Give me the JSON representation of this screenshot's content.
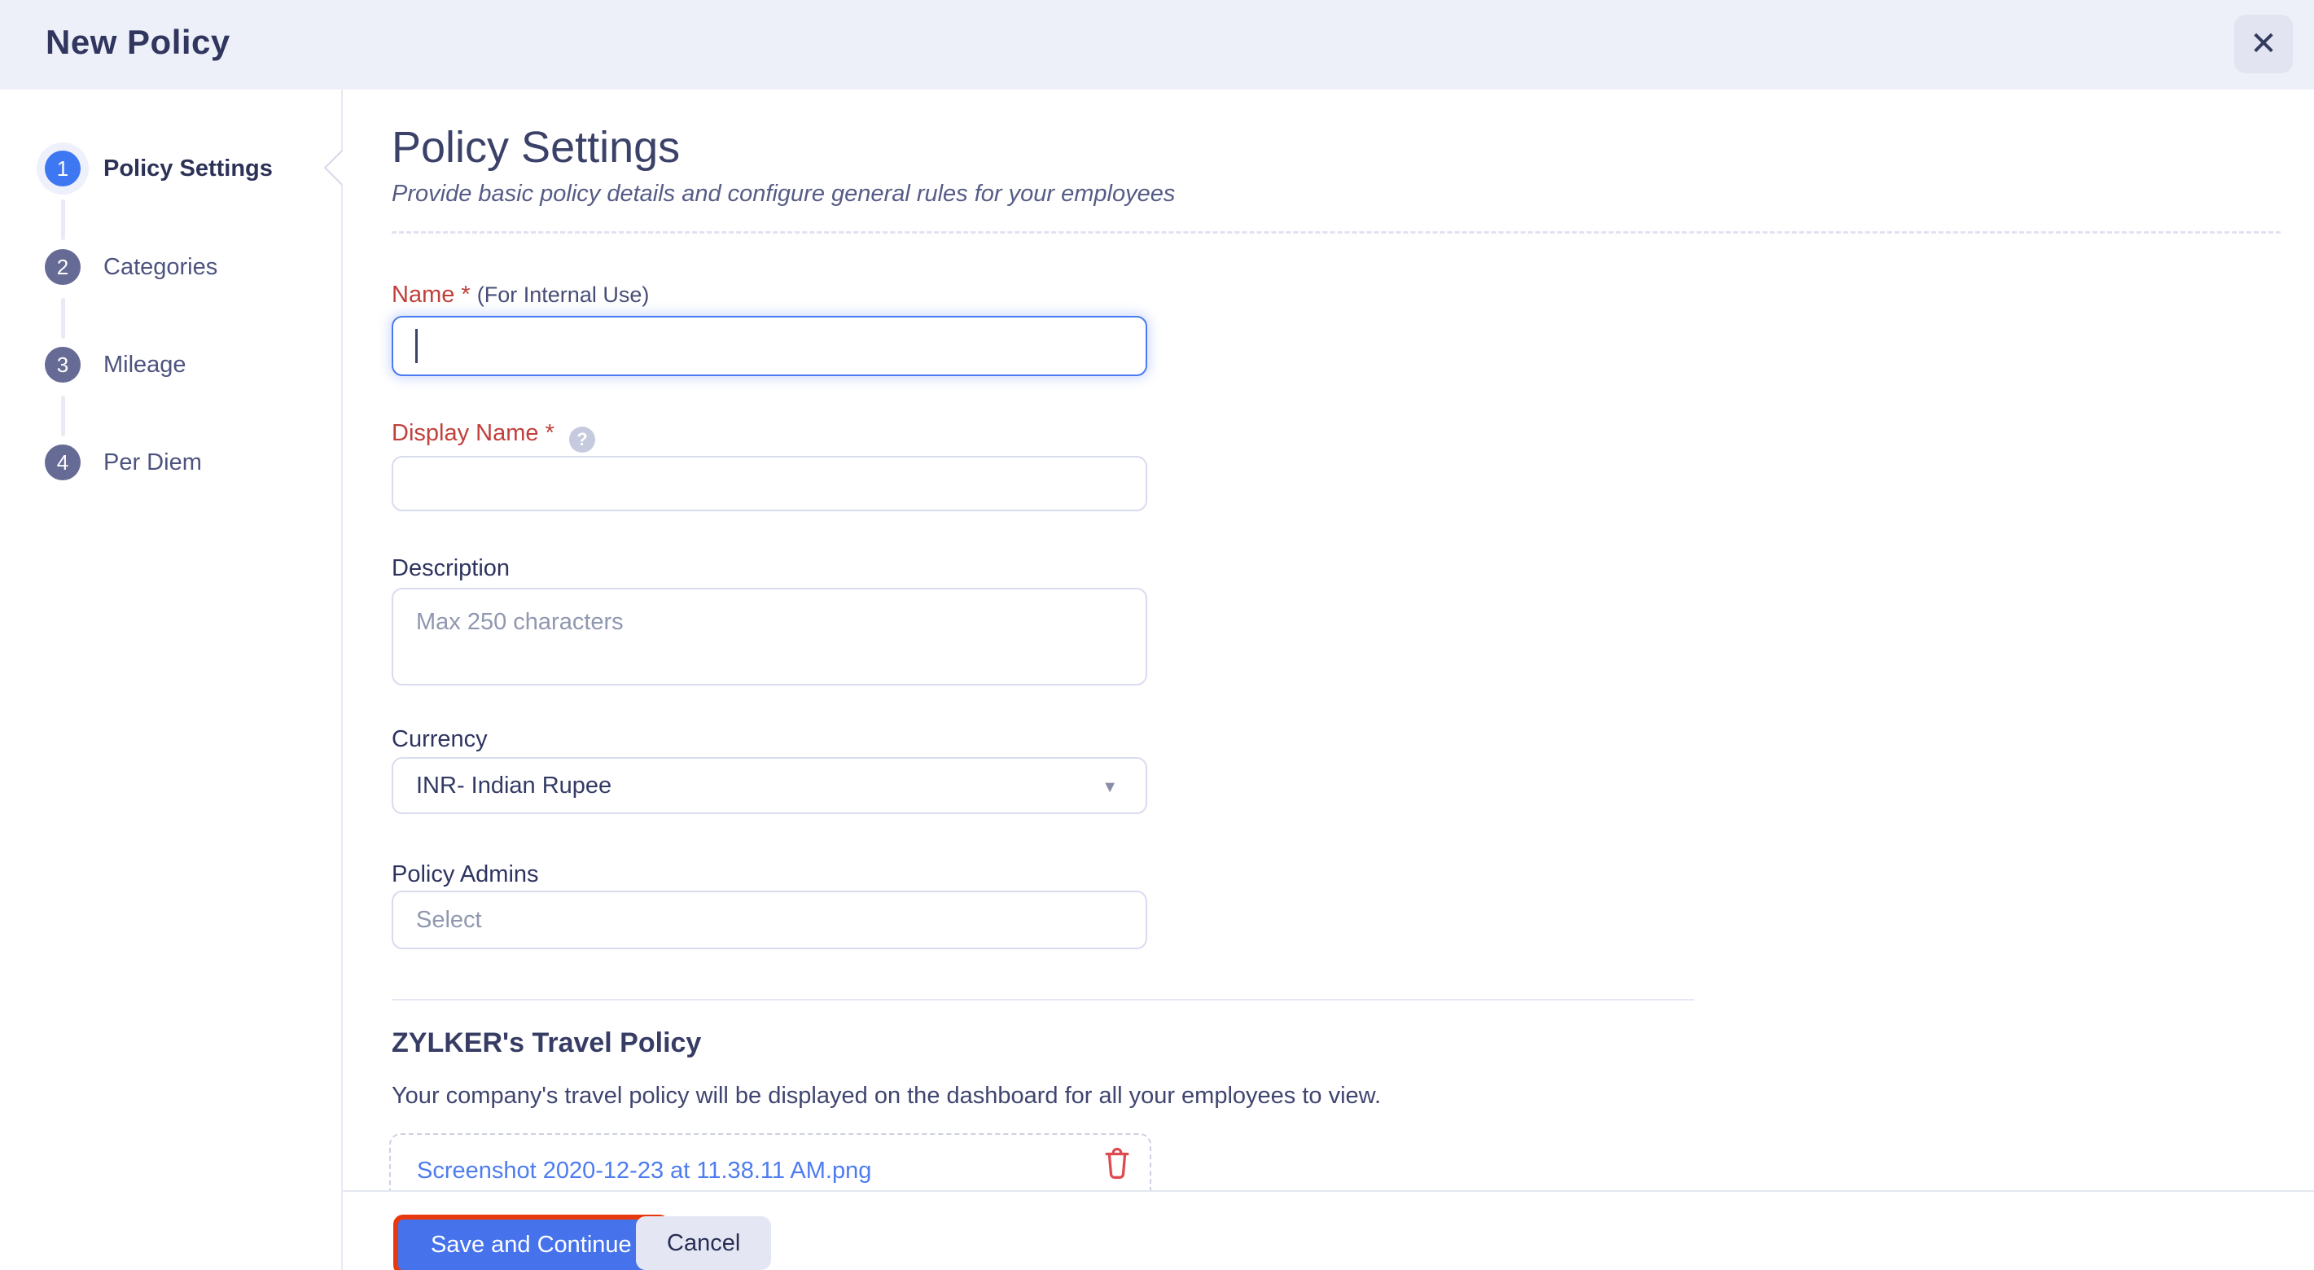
{
  "header": {
    "title": "New Policy"
  },
  "icons": {
    "close": "✕",
    "dropdown": "▼",
    "help": "?"
  },
  "stepper": {
    "steps": [
      {
        "number": "1",
        "label": "Policy Settings",
        "active": true
      },
      {
        "number": "2",
        "label": "Categories",
        "active": false
      },
      {
        "number": "3",
        "label": "Mileage",
        "active": false
      },
      {
        "number": "4",
        "label": "Per Diem",
        "active": false
      }
    ]
  },
  "main": {
    "title": "Policy Settings",
    "subtitle": "Provide basic policy details and configure general rules for your employees",
    "fields": {
      "name": {
        "label": "Name",
        "required_mark": "*",
        "hint": "(For Internal Use)",
        "value": ""
      },
      "display_name": {
        "label": "Display Name",
        "required_mark": "*",
        "value": ""
      },
      "description": {
        "label": "Description",
        "placeholder": "Max 250 characters",
        "value": ""
      },
      "currency": {
        "label": "Currency",
        "value": "INR- Indian Rupee"
      },
      "policy_admins": {
        "label": "Policy Admins",
        "placeholder": "Select",
        "value": ""
      }
    },
    "travel_policy": {
      "heading": "ZYLKER's Travel Policy",
      "description": "Your company's travel policy will be displayed on the dashboard for all your employees to view.",
      "attachment_filename": "Screenshot 2020-12-23 at 11.38.11 AM.png"
    }
  },
  "footer": {
    "save_label": "Save and Continue",
    "cancel_label": "Cancel"
  },
  "colors": {
    "header_bg": "#eef0f9",
    "active_step_blue": "#3d78f2",
    "inactive_step_slate": "#666b96",
    "required_label_red": "#c0403c",
    "focused_input_blue": "#4a7af0",
    "link_blue": "#4e7cf0",
    "trash_red": "#de4a51",
    "save_button_blue": "#4673ec",
    "annotation_red": "#e8380d"
  }
}
